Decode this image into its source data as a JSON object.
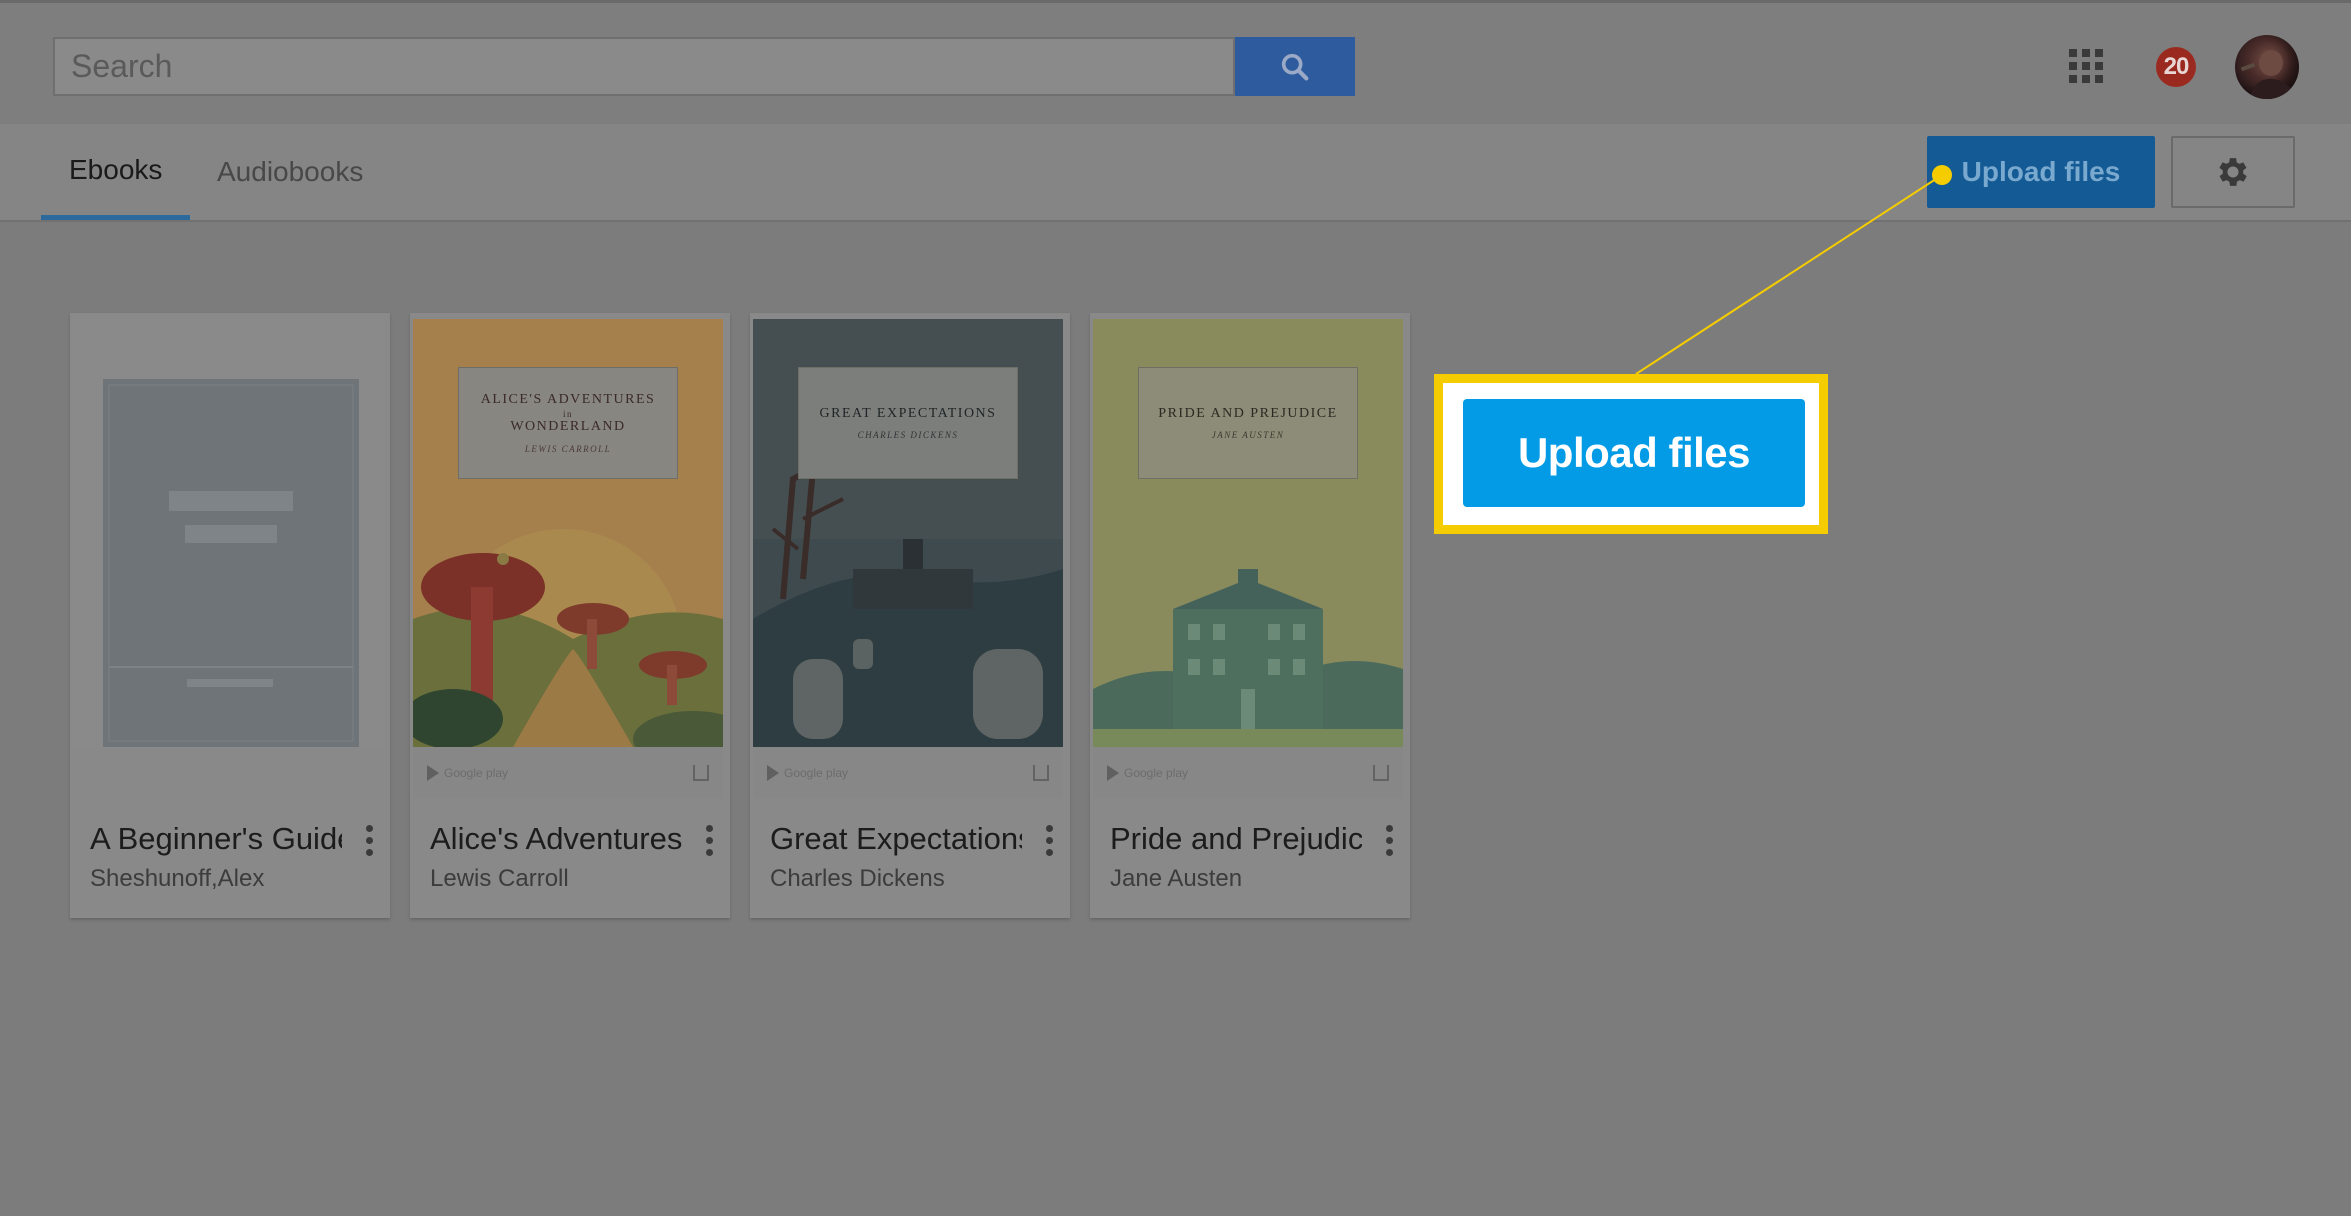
{
  "search": {
    "placeholder": "Search",
    "button_icon": "search-icon"
  },
  "header": {
    "apps_icon": "apps-grid-icon",
    "notification_count": "20",
    "avatar": "user-avatar"
  },
  "tabs": [
    {
      "label": "Ebooks",
      "active": true
    },
    {
      "label": "Audiobooks",
      "active": false
    }
  ],
  "toolbar": {
    "upload_label": "Upload files",
    "settings_icon": "gear-icon"
  },
  "books": [
    {
      "title": "A Beginner's Guide",
      "author": "Sheshunoff,Alex",
      "cover_title": "",
      "cover_author": "",
      "gp_text": ""
    },
    {
      "title": "Alice's Adventures",
      "author": "Lewis Carroll",
      "cover_title": "ALICE'S ADVENTURES",
      "cover_title_in": "in",
      "cover_title_2": "WONDERLAND",
      "cover_author": "LEWIS CARROLL",
      "gp_text": "Google play"
    },
    {
      "title": "Great Expectations",
      "author": "Charles Dickens",
      "cover_title": "GREAT EXPECTATIONS",
      "cover_author": "CHARLES DICKENS",
      "gp_text": "Google play"
    },
    {
      "title": "Pride and Prejudice",
      "author": "Jane Austen",
      "cover_title": "PRIDE AND PREJUDICE",
      "cover_author": "JANE AUSTEN",
      "gp_text": "Google play"
    }
  ],
  "callout": {
    "label": "Upload files"
  },
  "colors": {
    "accent_blue": "#039be5",
    "highlight_yellow": "#f5cc00",
    "dim_overlay": "#7c7c7c"
  }
}
